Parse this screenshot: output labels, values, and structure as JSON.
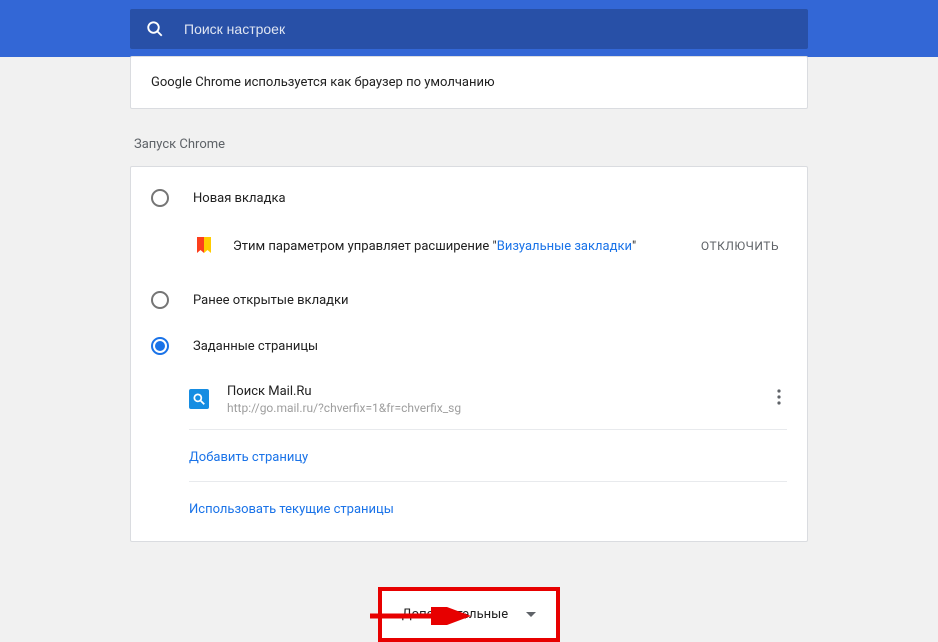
{
  "header": {
    "search_placeholder": "Поиск настроек"
  },
  "default_browser": {
    "text": "Google Chrome используется как браузер по умолчанию"
  },
  "startup": {
    "section_title": "Запуск Chrome",
    "options": {
      "new_tab": "Новая вкладка",
      "continue": "Ранее открытые вкладки",
      "specific": "Заданные страницы"
    },
    "extension_notice": {
      "prefix": "Этим параметром управляет расширение \"",
      "link": "Визуальные закладки",
      "suffix": "\"",
      "disable": "ОТКЛЮЧИТЬ"
    },
    "pages": [
      {
        "title": "Поиск Mail.Ru",
        "url": "http://go.mail.ru/?chverfix=1&fr=chverfix_sg"
      }
    ],
    "add_page": "Добавить страницу",
    "use_current": "Использовать текущие страницы"
  },
  "advanced": {
    "label": "Дополнительные"
  }
}
